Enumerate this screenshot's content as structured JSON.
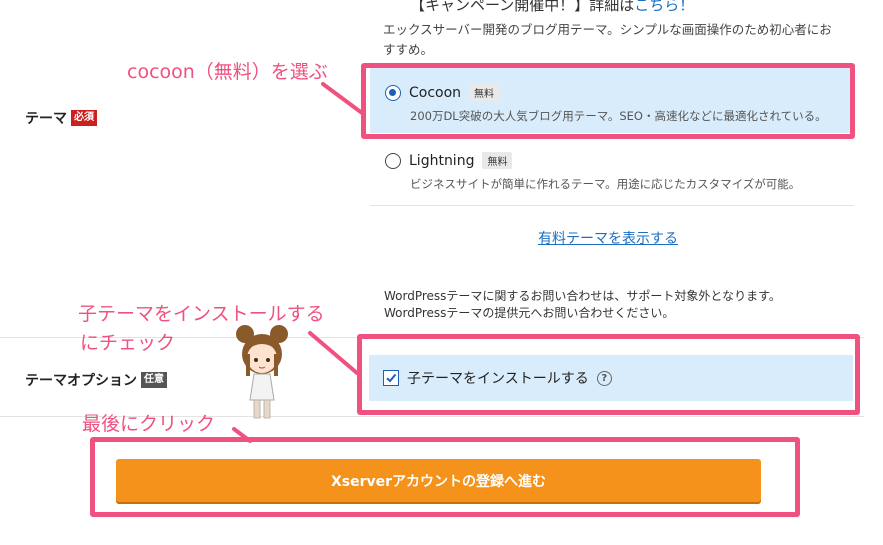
{
  "campaign": {
    "prefix": "【キャンペーン開催中！】詳細は",
    "link": "こちら！"
  },
  "intro_desc": "エックスサーバー開発のブログ用テーマ。シンプルな画面操作のため初心者におすすめ。",
  "theme_section": {
    "label": "テーマ",
    "badge": "必須",
    "options": [
      {
        "name": "Cocoon",
        "tag": "無料",
        "desc": "200万DL突破の大人気ブログ用テーマ。SEO・高速化などに最適化されている。",
        "selected": true
      },
      {
        "name": "Lightning",
        "tag": "無料",
        "desc": "ビジネスサイトが簡単に作れるテーマ。用途に応じたカスタマイズが可能。",
        "selected": false
      }
    ],
    "show_paid_link": "有料テーマを表示する"
  },
  "notice": {
    "line1": "WordPressテーマに関するお問い合わせは、サポート対象外となります。",
    "line2": "WordPressテーマの提供元へお問い合わせください。"
  },
  "theme_option": {
    "label": "テーマオプション",
    "badge": "任意",
    "checkbox_label": "子テーマをインストールする",
    "checked": true,
    "help": "?"
  },
  "submit_button": "Xserverアカウントの登録へ進む",
  "annotations": {
    "cocoon": "cocoon（無料）を選ぶ",
    "child_line1": "子テーマをインストールする",
    "child_line2": "にチェック",
    "last": "最後にクリック"
  },
  "colors": {
    "annotation": "#f0527f",
    "highlight_bg": "#d9ecfb",
    "button": "#f4921b",
    "link": "#1b6fc2",
    "required_badge": "#cc1f1f"
  },
  "icons": [
    "radio-selected-icon",
    "radio-unselected-icon",
    "checkbox-checked-icon",
    "help-icon",
    "character-illustration"
  ]
}
